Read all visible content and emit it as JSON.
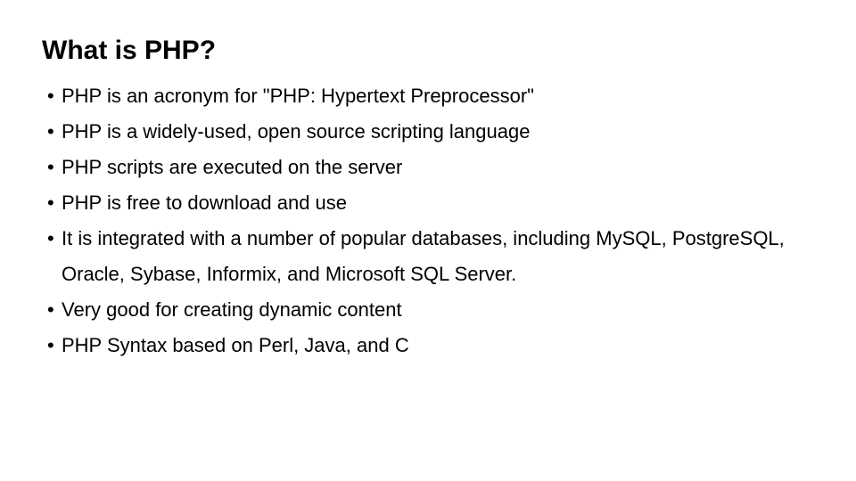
{
  "slide": {
    "title": "What is PHP?",
    "background_color": "#ffffff",
    "text_color": "#000000",
    "bullet_glyph": "•",
    "bullets": [
      {
        "marker": "•",
        "text": "PHP is an acronym for \"PHP: Hypertext Preprocessor\""
      },
      {
        "marker": "•",
        "text": "PHP is a widely-used, open source scripting language"
      },
      {
        "marker": "•",
        "text": "PHP scripts are executed on the server"
      },
      {
        "marker": "•",
        "text": "PHP is free to download and use"
      },
      {
        "marker": "•",
        "text": "It is integrated with a number of popular databases, including MySQL, PostgreSQL, Oracle, Sybase, Informix, and Microsoft SQL Server."
      },
      {
        "marker": "•",
        "text": "Very good for creating dynamic content"
      },
      {
        "marker": "•",
        "text": "PHP Syntax based on Perl, Java, and C"
      }
    ]
  }
}
